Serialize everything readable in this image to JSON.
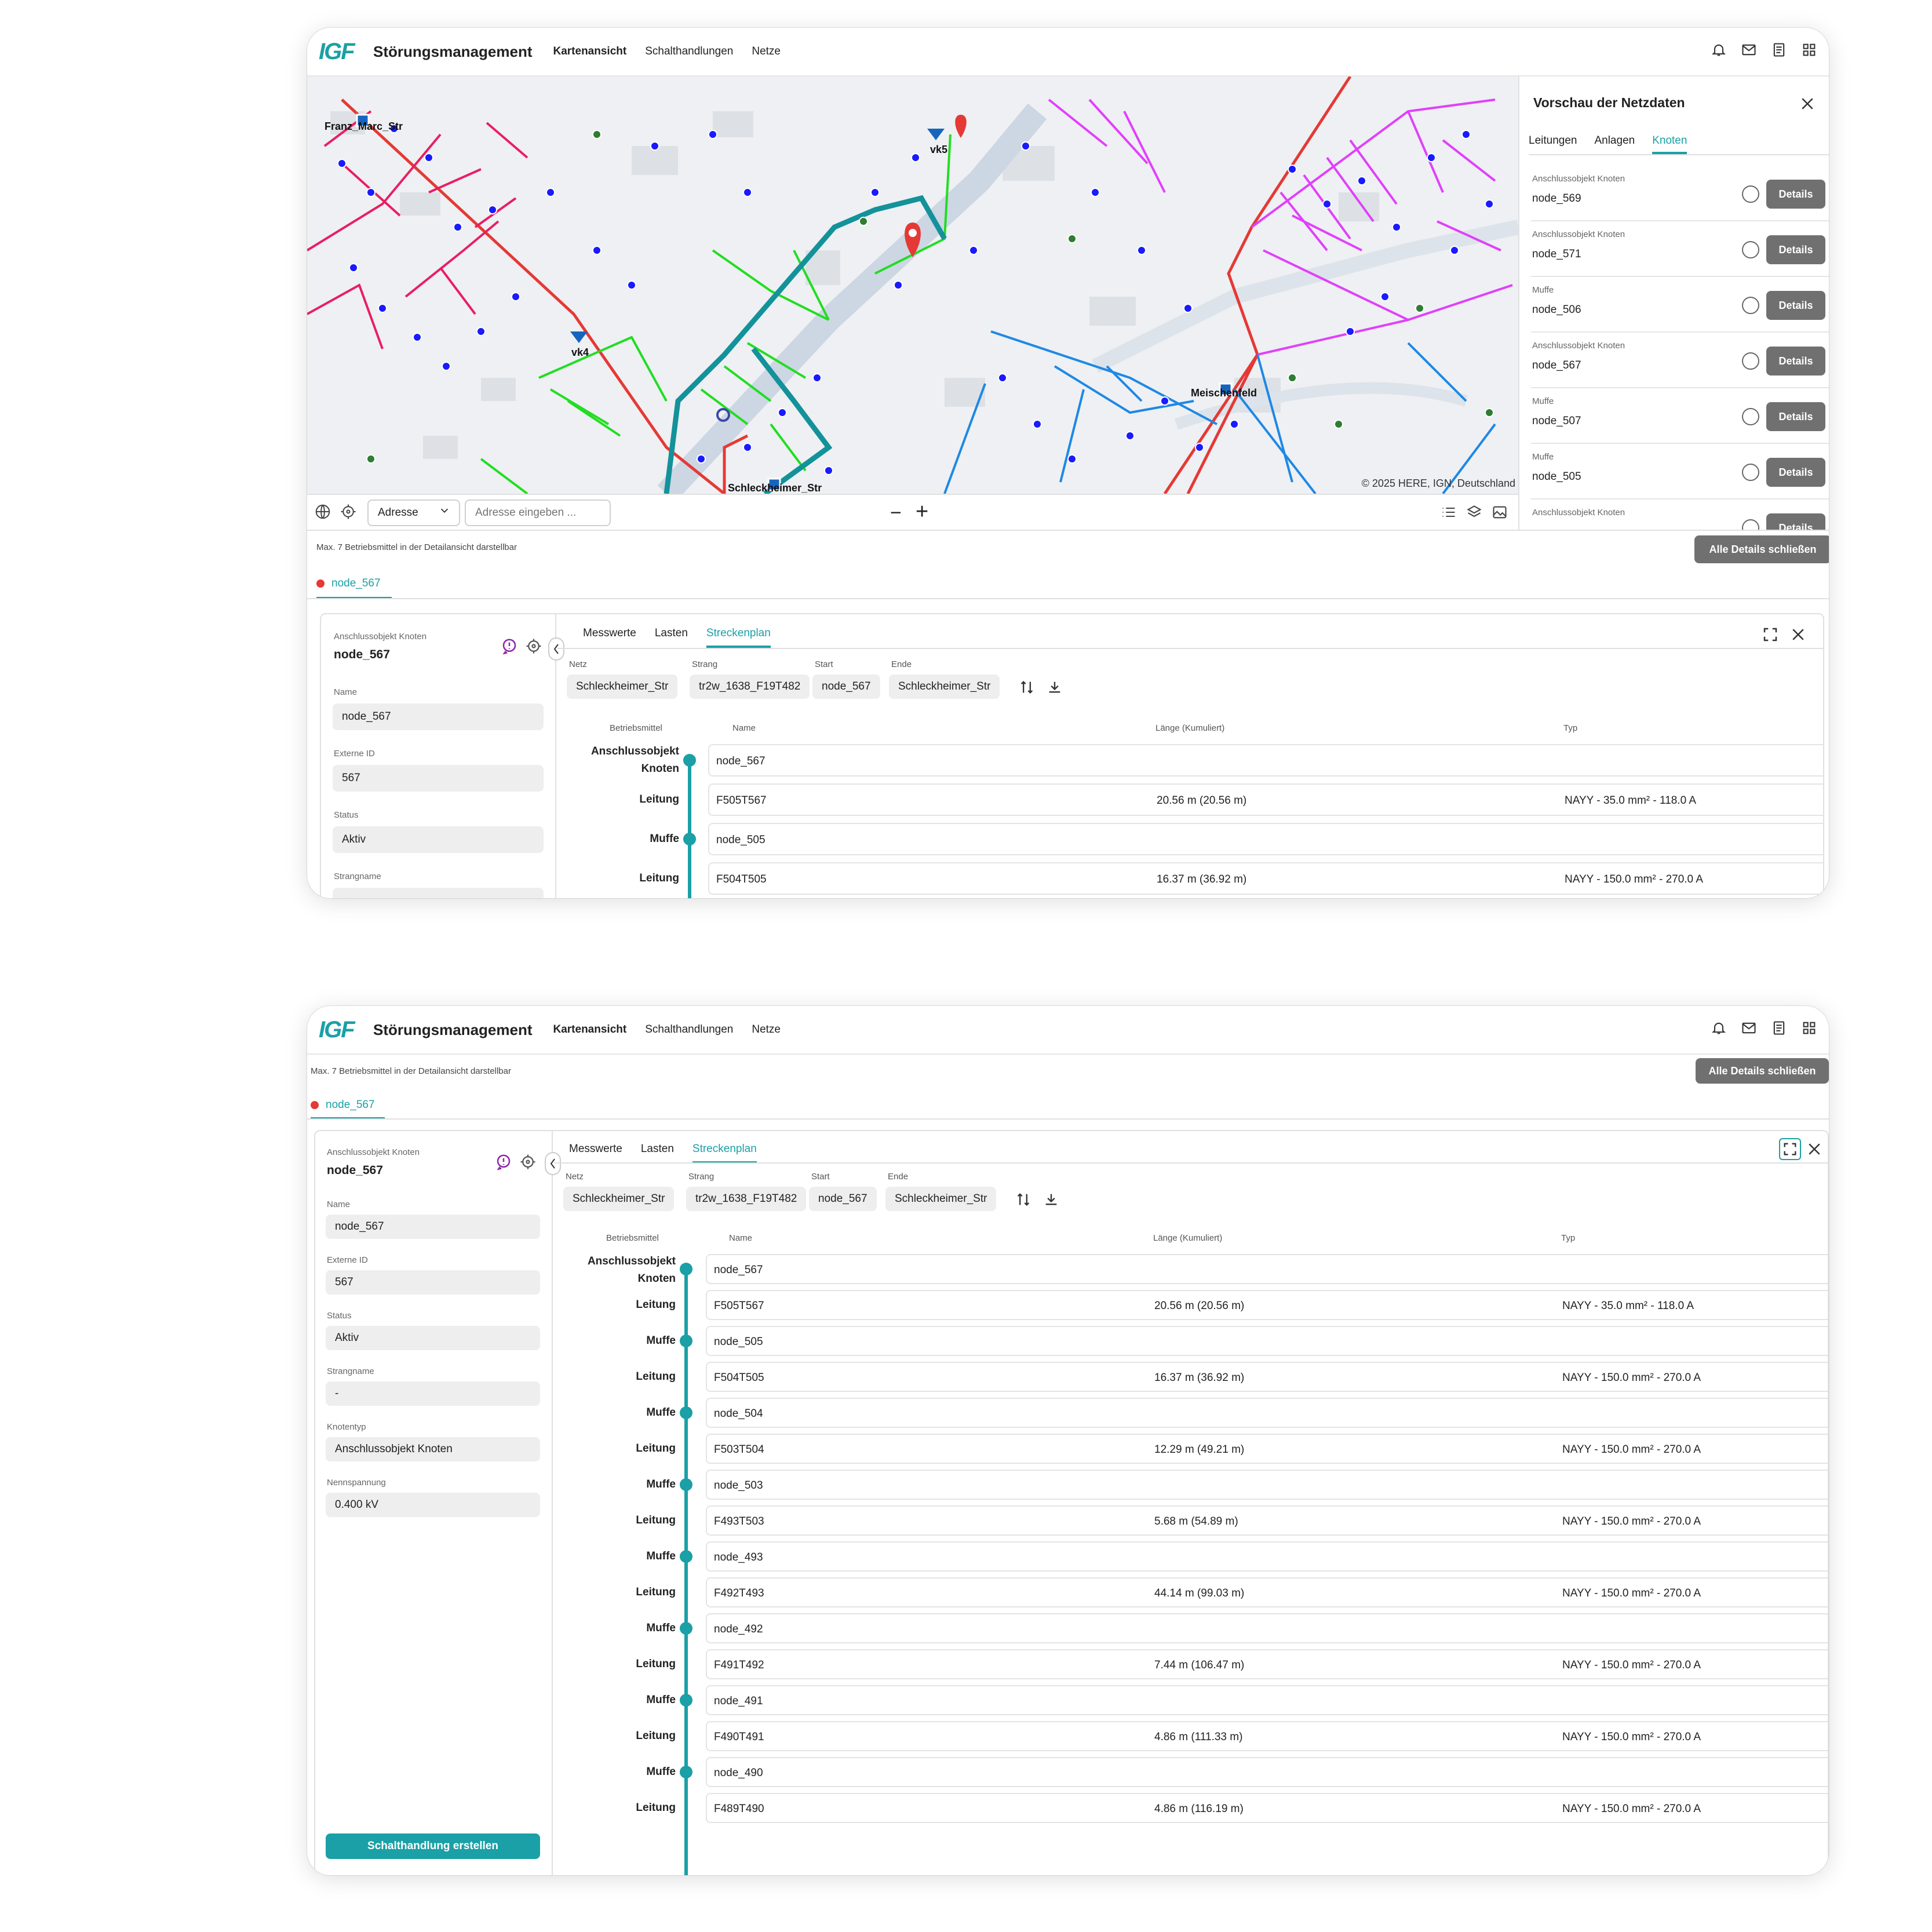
{
  "header": {
    "logo": "IGF",
    "title": "Störungsmanagement",
    "nav": [
      "Kartenansicht",
      "Schalthandlungen",
      "Netze"
    ]
  },
  "map": {
    "labels": [
      "Franz_Marc_Str",
      "vk5",
      "vk4",
      "Meischenfeld",
      "Schleckheimer_Str"
    ],
    "attribution": "© 2025 HERE, IGN, Deutschland",
    "address_select": "Adresse",
    "address_placeholder": "Adresse eingeben ..."
  },
  "preview": {
    "title": "Vorschau der Netzdaten",
    "tabs": [
      "Leitungen",
      "Anlagen",
      "Knoten"
    ],
    "active_tab": "Knoten",
    "details_label": "Details",
    "items": [
      {
        "type": "Anschlussobjekt Knoten",
        "name": "node_569"
      },
      {
        "type": "Anschlussobjekt Knoten",
        "name": "node_571"
      },
      {
        "type": "Muffe",
        "name": "node_506"
      },
      {
        "type": "Anschlussobjekt Knoten",
        "name": "node_567"
      },
      {
        "type": "Muffe",
        "name": "node_507"
      },
      {
        "type": "Muffe",
        "name": "node_505"
      },
      {
        "type": "Anschlussobjekt Knoten",
        "name": ""
      }
    ]
  },
  "detail": {
    "max_note": "Max. 7 Betriebsmittel in der Detailansicht darstellbar",
    "close_all": "Alle Details schließen",
    "chip": "node_567",
    "object_type": "Anschlussobjekt Knoten",
    "object_name": "node_567",
    "fields": [
      {
        "label": "Name",
        "value": "node_567"
      },
      {
        "label": "Externe ID",
        "value": "567"
      },
      {
        "label": "Status",
        "value": "Aktiv"
      },
      {
        "label": "Strangname",
        "value": "-"
      },
      {
        "label": "Knotentyp",
        "value": "Anschlussobjekt Knoten"
      },
      {
        "label": "Nennspannung",
        "value": "0.400 kV"
      }
    ],
    "tabs": [
      "Messwerte",
      "Lasten",
      "Streckenplan"
    ],
    "active_tab": "Streckenplan",
    "route": {
      "caption_netz": "Netz",
      "caption_strang": "Strang",
      "caption_start": "Start",
      "caption_ende": "Ende",
      "netz": "Schleckheimer_Str",
      "strang": "tr2w_1638_F19T482",
      "start": "node_567",
      "ende": "Schleckheimer_Str"
    },
    "columns": [
      "Betriebsmittel",
      "Name",
      "Länge (Kumuliert)",
      "Typ"
    ],
    "rows": [
      {
        "kind": "Anschlussobjekt Knoten",
        "name": "node_567",
        "len": "",
        "typ": ""
      },
      {
        "kind": "Leitung",
        "name": "F505T567",
        "len": "20.56 m (20.56 m)",
        "typ": "NAYY - 35.0 mm² - 118.0 A"
      },
      {
        "kind": "Muffe",
        "name": "node_505",
        "len": "",
        "typ": ""
      },
      {
        "kind": "Leitung",
        "name": "F504T505",
        "len": "16.37 m (36.92 m)",
        "typ": "NAYY - 150.0 mm² - 270.0 A"
      },
      {
        "kind": "Muffe",
        "name": "node_504",
        "len": "",
        "typ": ""
      },
      {
        "kind": "Leitung",
        "name": "F503T504",
        "len": "12.29 m (49.21 m)",
        "typ": "NAYY - 150.0 mm² - 270.0 A"
      },
      {
        "kind": "Muffe",
        "name": "node_503",
        "len": "",
        "typ": ""
      },
      {
        "kind": "Leitung",
        "name": "F493T503",
        "len": "5.68 m (54.89 m)",
        "typ": "NAYY - 150.0 mm² - 270.0 A"
      },
      {
        "kind": "Muffe",
        "name": "node_493",
        "len": "",
        "typ": ""
      },
      {
        "kind": "Leitung",
        "name": "F492T493",
        "len": "44.14 m (99.03 m)",
        "typ": "NAYY - 150.0 mm² - 270.0 A"
      },
      {
        "kind": "Muffe",
        "name": "node_492",
        "len": "",
        "typ": ""
      },
      {
        "kind": "Leitung",
        "name": "F491T492",
        "len": "7.44 m (106.47 m)",
        "typ": "NAYY - 150.0 mm² - 270.0 A"
      },
      {
        "kind": "Muffe",
        "name": "node_491",
        "len": "",
        "typ": ""
      },
      {
        "kind": "Leitung",
        "name": "F490T491",
        "len": "4.86 m (111.33 m)",
        "typ": "NAYY - 150.0 mm² - 270.0 A"
      },
      {
        "kind": "Muffe",
        "name": "node_490",
        "len": "",
        "typ": ""
      },
      {
        "kind": "Leitung",
        "name": "F489T490",
        "len": "4.86 m (116.19 m)",
        "typ": "NAYY - 150.0 mm² - 270.0 A"
      }
    ],
    "create_action": "Schalthandlung erstellen"
  },
  "colors": {
    "accent": "#1aa0a6",
    "net_red": "#e53935",
    "net_pink": "#e91e63",
    "net_magenta": "#e040fb",
    "net_green": "#22dd22",
    "net_blue": "#1e88e5",
    "node": "#1a1aff"
  }
}
